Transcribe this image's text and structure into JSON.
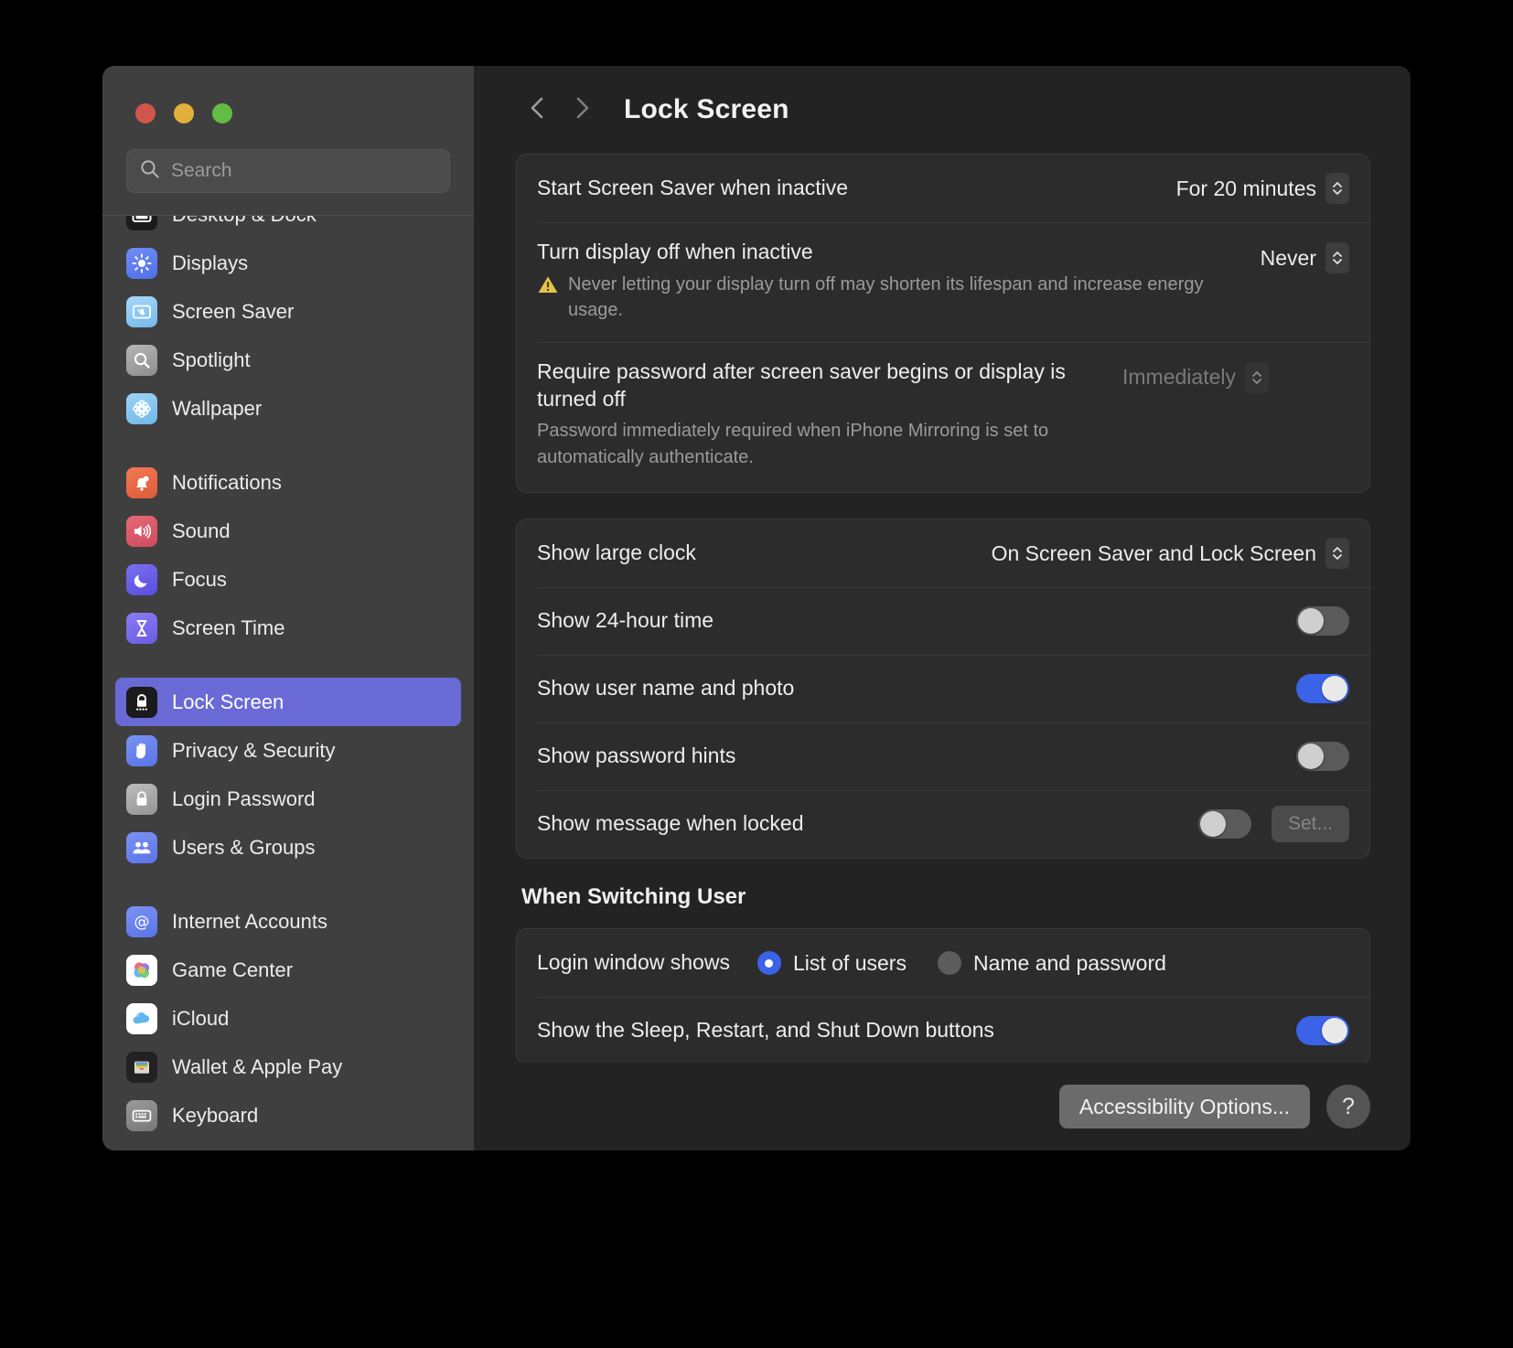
{
  "window": {
    "traffic_lights": [
      "close",
      "minimize",
      "maximize"
    ],
    "colors": {
      "accent": "#3b63e8",
      "selection": "#6a6ad6",
      "sidebar_bg": "#3f3f3f",
      "content_bg": "#232323",
      "card_bg": "#2c2c2c",
      "warning": "#e8c14a"
    }
  },
  "search": {
    "placeholder": "Search",
    "value": "",
    "icon": "search-icon"
  },
  "sidebar": {
    "items": [
      {
        "label": "Desktop & Dock",
        "icon": "desktop-dock-icon",
        "selected": false
      },
      {
        "label": "Displays",
        "icon": "displays-icon",
        "selected": false
      },
      {
        "label": "Screen Saver",
        "icon": "screen-saver-icon",
        "selected": false
      },
      {
        "label": "Spotlight",
        "icon": "spotlight-icon",
        "selected": false
      },
      {
        "label": "Wallpaper",
        "icon": "wallpaper-icon",
        "selected": false
      },
      {
        "label": "Notifications",
        "icon": "notifications-icon",
        "selected": false
      },
      {
        "label": "Sound",
        "icon": "sound-icon",
        "selected": false
      },
      {
        "label": "Focus",
        "icon": "focus-icon",
        "selected": false
      },
      {
        "label": "Screen Time",
        "icon": "screen-time-icon",
        "selected": false
      },
      {
        "label": "Lock Screen",
        "icon": "lock-screen-icon",
        "selected": true
      },
      {
        "label": "Privacy & Security",
        "icon": "privacy-security-icon",
        "selected": false
      },
      {
        "label": "Login Password",
        "icon": "login-password-icon",
        "selected": false
      },
      {
        "label": "Users & Groups",
        "icon": "users-groups-icon",
        "selected": false
      },
      {
        "label": "Internet Accounts",
        "icon": "internet-accounts-icon",
        "selected": false
      },
      {
        "label": "Game Center",
        "icon": "game-center-icon",
        "selected": false
      },
      {
        "label": "iCloud",
        "icon": "icloud-icon",
        "selected": false
      },
      {
        "label": "Wallet & Apple Pay",
        "icon": "wallet-apple-pay-icon",
        "selected": false
      },
      {
        "label": "Keyboard",
        "icon": "keyboard-icon",
        "selected": false
      }
    ]
  },
  "toolbar": {
    "back_icon": "chevron-left-icon",
    "forward_icon": "chevron-right-icon",
    "title": "Lock Screen"
  },
  "main": {
    "group_timing": {
      "rows": [
        {
          "label": "Start Screen Saver when inactive",
          "value": "For 20 minutes",
          "control": "popup",
          "disabled": false
        },
        {
          "label": "Turn display off when inactive",
          "value": "Never",
          "control": "popup",
          "disabled": false,
          "warning": "Never letting your display turn off may shorten its lifespan and increase energy usage."
        },
        {
          "label": "Require password after screen saver begins or display is turned off",
          "value": "Immediately",
          "control": "popup",
          "disabled": true,
          "note": "Password immediately required when iPhone Mirroring is set to automatically authenticate."
        }
      ]
    },
    "group_display": {
      "rows": [
        {
          "label": "Show large clock",
          "value": "On Screen Saver and Lock Screen",
          "control": "popup",
          "disabled": false
        },
        {
          "label": "Show 24-hour time",
          "control": "switch",
          "on": false
        },
        {
          "label": "Show user name and photo",
          "control": "switch",
          "on": true
        },
        {
          "label": "Show password hints",
          "control": "switch",
          "on": false
        },
        {
          "label": "Show message when locked",
          "control": "switch",
          "on": false,
          "button_label": "Set...",
          "button_disabled": true
        }
      ]
    },
    "switching_user": {
      "title": "When Switching User",
      "login_window_label": "Login window shows",
      "options": [
        {
          "label": "List of users",
          "selected": true
        },
        {
          "label": "Name and password",
          "selected": false
        }
      ],
      "sleep_restart_label": "Show the Sleep, Restart, and Shut Down buttons",
      "sleep_restart_on": true
    }
  },
  "footer": {
    "accessibility_label": "Accessibility Options...",
    "help_label": "?"
  }
}
